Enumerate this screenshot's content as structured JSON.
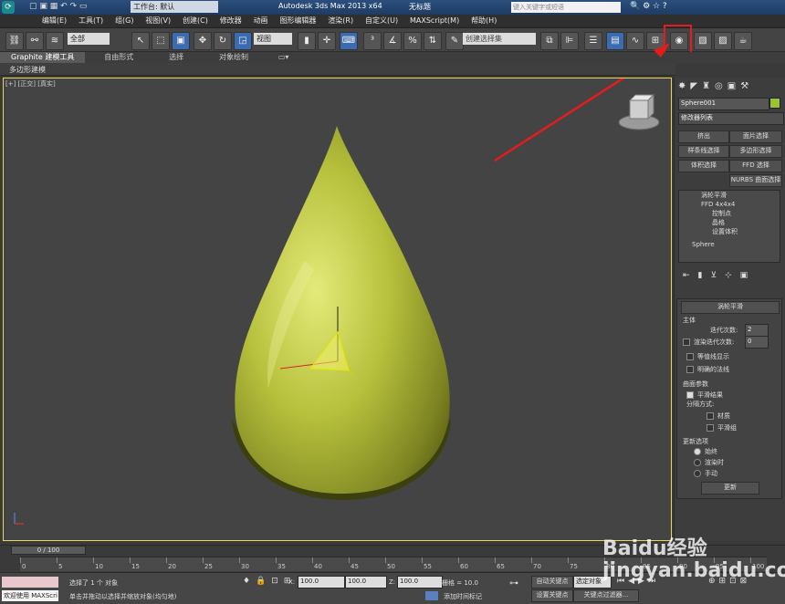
{
  "title": {
    "workspace": "工作台: 默认",
    "app_name": "Autodesk 3ds Max  2013 x64",
    "doc": "无标题",
    "search_placeholder": "键入关键字或短语"
  },
  "menu": [
    "编辑(E)",
    "工具(T)",
    "组(G)",
    "视图(V)",
    "创建(C)",
    "修改器",
    "动画",
    "图形编辑器",
    "渲染(R)",
    "自定义(U)",
    "MAXScript(M)",
    "帮助(H)"
  ],
  "toolbar": {
    "filter": "全部",
    "view": "视图",
    "selection_set": "创建选择集"
  },
  "ribbon": {
    "tabs": [
      "Graphite 建模工具",
      "自由形式",
      "选择",
      "对象绘制"
    ],
    "sub_label": "多边形建模"
  },
  "viewport": {
    "label": "[+] [正交] [真实]"
  },
  "cmd_panel": {
    "object_name": "Sphere001",
    "modifier_list": "修改器列表",
    "buttons": [
      "挤出",
      "面片选择",
      "样条线选择",
      "多边形选择",
      "体积选择",
      "FFD 选择",
      "NURBS 曲面选择"
    ],
    "stack": [
      "涡轮平滑",
      "FFD 4x4x4",
      "控制点",
      "晶格",
      "设置体积",
      "Sphere"
    ],
    "rollout": {
      "title": "涡轮平滑",
      "main": "主体",
      "iterations_label": "迭代次数:",
      "iterations": "2",
      "render_iters_label": "渲染迭代次数:",
      "render_iters": "0",
      "isoline": "等值线显示",
      "explicit_normals": "明确的法线",
      "surface_params": "曲面参数",
      "smooth_result": "平滑结果",
      "separate_by": "分隔方式:",
      "materials": "材质",
      "smoothing_groups": "平滑组",
      "update_options": "更新选项",
      "always": "始终",
      "when_rendering": "渲染时",
      "manually": "手动",
      "update_btn": "更新"
    }
  },
  "timeline": {
    "frame": "0 / 100",
    "ticks": [
      "0",
      "5",
      "10",
      "15",
      "20",
      "25",
      "30",
      "35",
      "40",
      "45",
      "50",
      "55",
      "60",
      "65",
      "70",
      "75",
      "80",
      "85",
      "90",
      "95",
      "100"
    ]
  },
  "status": {
    "welcome": "欢迎使用 MAXScri",
    "selected": "选择了 1 个 对象",
    "hint": "单击并拖动以选择并缩放对象(均匀地)",
    "x_label": "X:",
    "x": "100.0",
    "y_label": "Y:",
    "y": "100.0",
    "z_label": "Z:",
    "z": "100.0",
    "grid": "栅格 = 10.0",
    "add_time_tag": "添加时间标记",
    "auto_key": "自动关键点",
    "selected_obj": "选定对象",
    "set_key": "设置关键点",
    "key_filters": "关键点过滤器..."
  },
  "watermark": "Baidu经验 jingyan.baidu.com",
  "colors": {
    "accent_red": "#e41c1c",
    "drop_green": "#b7c13c",
    "viewport_border": "#e8d95a"
  }
}
